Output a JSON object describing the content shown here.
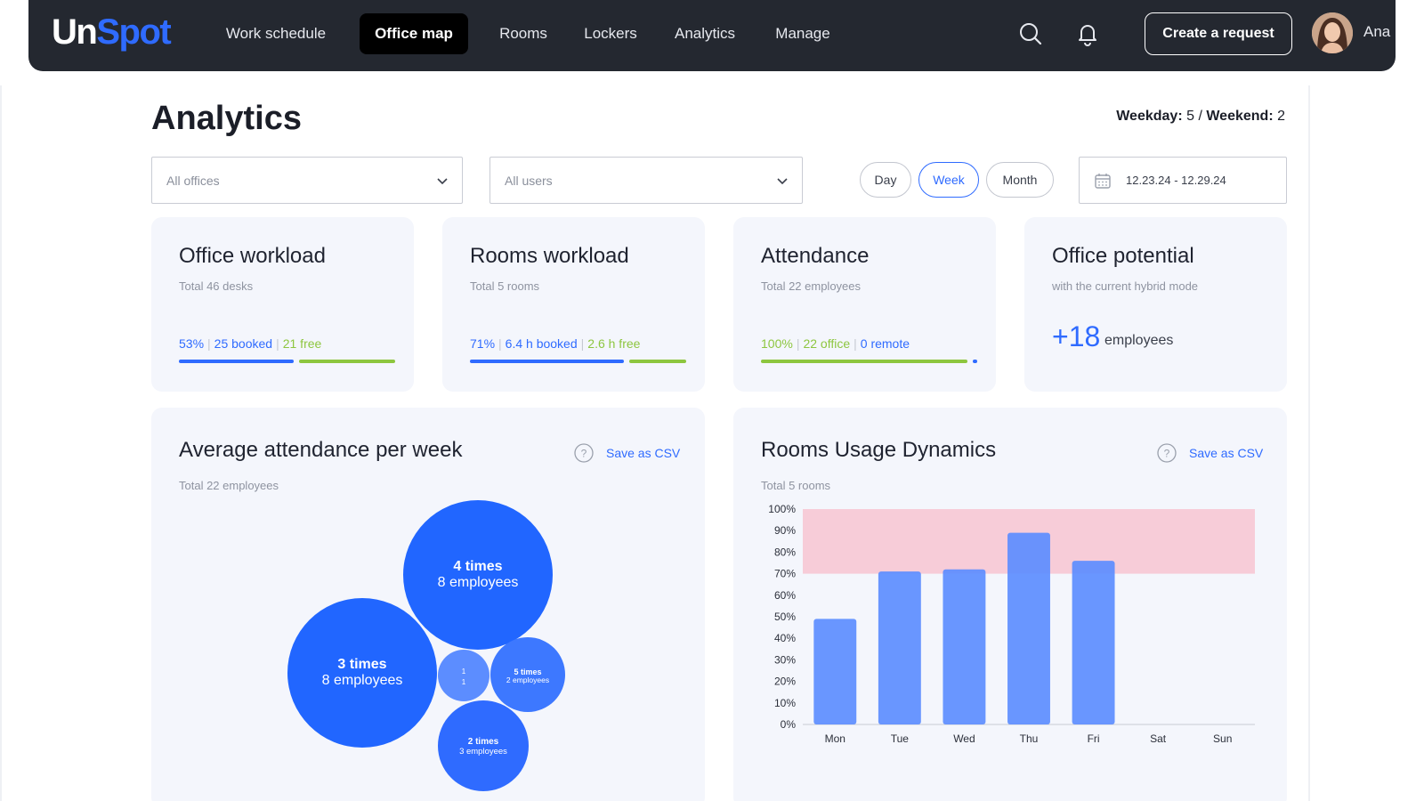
{
  "app": {
    "logo_part1": "Un",
    "logo_part2": "Spot"
  },
  "nav": {
    "items": [
      {
        "label": "Work schedule"
      },
      {
        "label": "Office map"
      },
      {
        "label": "Rooms"
      },
      {
        "label": "Lockers"
      },
      {
        "label": "Analytics"
      },
      {
        "label": "Manage"
      }
    ],
    "active": "Office map",
    "create_request": "Create a request",
    "user_name": "Ana",
    "icons": [
      "search-icon",
      "bell-icon"
    ]
  },
  "page": {
    "title": "Analytics",
    "weekday_label": "Weekday:",
    "weekday_value": "5",
    "divider": "/",
    "weekend_label": "Weekend:",
    "weekend_value": "2"
  },
  "filters": {
    "offices": "All offices",
    "users": "All users",
    "periods": [
      "Day",
      "Week",
      "Month"
    ],
    "active_period": "Week",
    "date_range": "12.23.24 - 12.29.24"
  },
  "cards": {
    "office_workload": {
      "title": "Office workload",
      "subtitle": "Total 46 desks",
      "percent": "53%",
      "booked": "25 booked",
      "free": "21 free",
      "share_booked": 0.53
    },
    "rooms_workload": {
      "title": "Rooms workload",
      "subtitle": "Total 5 rooms",
      "percent": "71%",
      "booked": "6.4 h booked",
      "free": "2.6 h free",
      "share_booked": 0.71
    },
    "attendance": {
      "title": "Attendance",
      "subtitle": "Total 22 employees",
      "percent": "100%",
      "office": "22 office",
      "remote": "0 remote",
      "share_office": 1.0
    },
    "office_potential": {
      "title": "Office potential",
      "subtitle": "with the current hybrid mode",
      "value": "+18",
      "unit": "employees"
    }
  },
  "attendance_chart": {
    "title": "Average attendance per week",
    "subtitle": "Total 22 employees",
    "csv": "Save as CSV",
    "bubbles": [
      {
        "line1": "4 times",
        "line2": "8 employees",
        "count": 8
      },
      {
        "line1": "3 times",
        "line2": "8 employees",
        "count": 8
      },
      {
        "line1": "1",
        "line2": "1",
        "count": 1
      },
      {
        "line1": "5 times",
        "line2": "2 employees",
        "count": 2
      },
      {
        "line1": "2 times",
        "line2": "3 employees",
        "count": 3
      }
    ]
  },
  "rooms_chart": {
    "title": "Rooms Usage Dynamics",
    "subtitle": "Total 5 rooms",
    "csv": "Save as CSV"
  },
  "chart_data": [
    {
      "type": "bar",
      "categories": [
        "Mon",
        "Tue",
        "Wed",
        "Thu",
        "Fri",
        "Sat",
        "Sun"
      ],
      "values": [
        49,
        71,
        72,
        89,
        76,
        0,
        0
      ],
      "yticks": [
        "0%",
        "10%",
        "20%",
        "30%",
        "40%",
        "50%",
        "60%",
        "70%",
        "80%",
        "90%",
        "100%"
      ],
      "ylim": [
        0,
        100
      ],
      "overload_band": [
        70,
        100
      ],
      "bar_color": "#5c8dff",
      "band_color": "#f7ccd8"
    }
  ],
  "colors": {
    "accent": "#2f6bff",
    "green": "#8dc63f",
    "nav_bg": "#242830",
    "card_bg": "#f4f6fc"
  }
}
